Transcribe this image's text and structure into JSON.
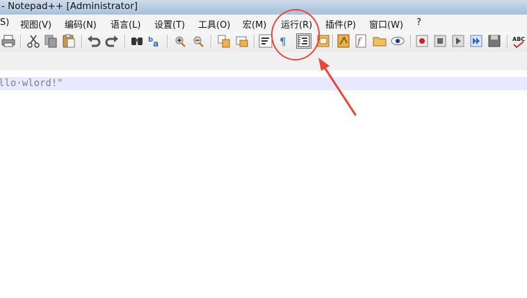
{
  "window": {
    "title": "- Notepad++ [Administrator]"
  },
  "menu": {
    "items": [
      "S)",
      "视图(V)",
      "编码(N)",
      "语言(L)",
      "设置(T)",
      "工具(O)",
      "宏(M)",
      "运行(R)",
      "插件(P)",
      "窗口(W)",
      "?"
    ]
  },
  "toolbar": {
    "icons": [
      "print-icon",
      "cut-icon",
      "copy-icon",
      "paste-icon",
      "undo-icon",
      "redo-icon",
      "find-icon",
      "replace-icon",
      "zoom-in-icon",
      "zoom-out-icon",
      "sync-vertical-icon",
      "sync-horizontal-icon",
      "word-wrap-icon",
      "show-all-chars-icon",
      "indent-guide-icon",
      "user-lang-icon",
      "doc-map-icon",
      "function-list-icon",
      "folder-workspace-icon",
      "monitoring-icon",
      "record-macro-icon",
      "stop-record-icon",
      "play-macro-icon",
      "run-macro-multiple-icon",
      "save-macro-icon",
      "spell-check-icon"
    ],
    "pressed": "indent-guide-icon"
  },
  "editor": {
    "line_text": "llo·wlord!\""
  },
  "annotation": {
    "color": "#e8473a"
  }
}
